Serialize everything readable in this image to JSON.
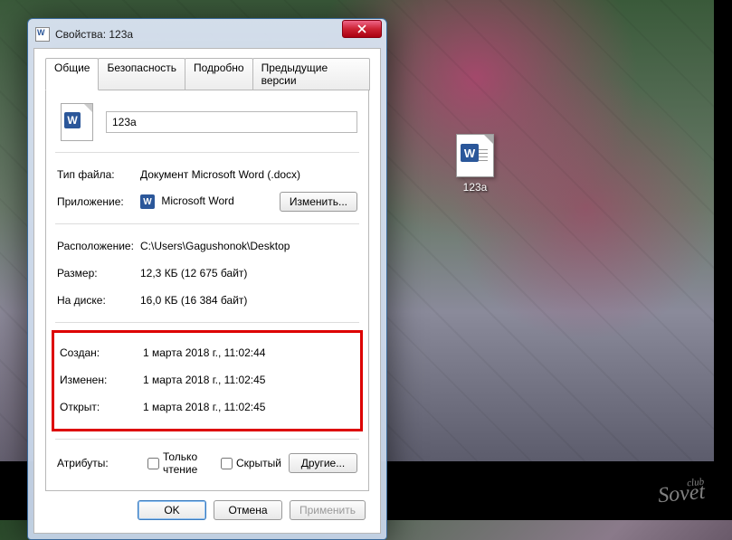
{
  "desktop": {
    "file_label": "123a",
    "watermark_small": "club",
    "watermark": "Sovet"
  },
  "dialog": {
    "title": "Свойства: 123a",
    "tabs": {
      "general": "Общие",
      "security": "Безопасность",
      "details": "Подробно",
      "previous": "Предыдущие версии"
    },
    "filename": "123a",
    "labels": {
      "filetype": "Тип файла:",
      "app": "Приложение:",
      "location": "Расположение:",
      "size": "Размер:",
      "size_on_disk": "На диске:",
      "created": "Создан:",
      "modified": "Изменен:",
      "accessed": "Открыт:",
      "attributes": "Атрибуты:",
      "readonly": "Только чтение",
      "hidden": "Скрытый"
    },
    "values": {
      "filetype": "Документ Microsoft Word (.docx)",
      "app": "Microsoft Word",
      "location": "C:\\Users\\Gagushonok\\Desktop",
      "size": "12,3 КБ (12 675 байт)",
      "size_on_disk": "16,0 КБ (16 384 байт)",
      "created": "1 марта 2018 г., 11:02:44",
      "modified": "1 марта 2018 г., 11:02:45",
      "accessed": "1 марта 2018 г., 11:02:45"
    },
    "buttons": {
      "change": "Изменить...",
      "other": "Другие...",
      "ok": "OK",
      "cancel": "Отмена",
      "apply": "Применить"
    }
  }
}
